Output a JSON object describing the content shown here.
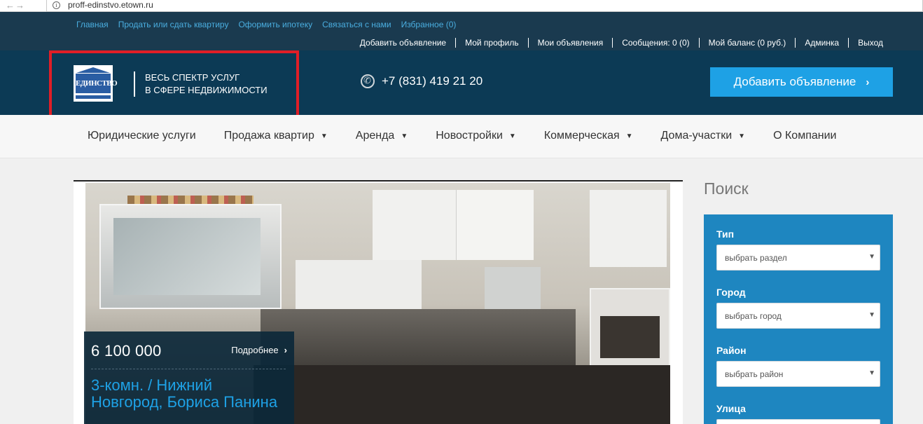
{
  "browser": {
    "url": "proff-edinstvo.etown.ru"
  },
  "top_links": [
    "Главная",
    "Продать или сдать квартиру",
    "Оформить ипотеку",
    "Связаться с нами",
    "Избранное (0)"
  ],
  "user_links": [
    "Добавить объявление",
    "Мой профиль",
    "Мои объявления",
    "Сообщения: 0 (0)",
    "Мой баланс (0 руб.)",
    "Админка",
    "Выход"
  ],
  "header": {
    "logo_text": "ЕДИНСТВО",
    "slogan_line1": "ВЕСЬ СПЕКТР УСЛУГ",
    "slogan_line2": "В СФЕРЕ НЕДВИЖИМОСТИ",
    "phone": "+7 (831) 419 21 20",
    "add_button": "Добавить объявление"
  },
  "nav": [
    {
      "label": "Юридические услуги",
      "dropdown": false
    },
    {
      "label": "Продажа квартир",
      "dropdown": true
    },
    {
      "label": "Аренда",
      "dropdown": true
    },
    {
      "label": "Новостройки",
      "dropdown": true
    },
    {
      "label": "Коммерческая",
      "dropdown": true
    },
    {
      "label": "Дома-участки",
      "dropdown": true
    },
    {
      "label": "О Компании",
      "dropdown": false
    }
  ],
  "listing": {
    "price": "6 100 000",
    "more_label": "Подробнее",
    "title": "3-комн. / Нижний Новгород, Бориса Панина"
  },
  "search": {
    "heading": "Поиск",
    "fields": [
      {
        "label": "Тип",
        "value": "выбрать раздел"
      },
      {
        "label": "Город",
        "value": "выбрать город"
      },
      {
        "label": "Район",
        "value": "выбрать район"
      },
      {
        "label": "Улица",
        "value": ""
      }
    ]
  },
  "colors": {
    "top_strip": "#1a3a4f",
    "header_bg": "#0c3a55",
    "accent": "#1ea1e5",
    "search_panel": "#1e86c0",
    "highlight": "#e01e27"
  }
}
